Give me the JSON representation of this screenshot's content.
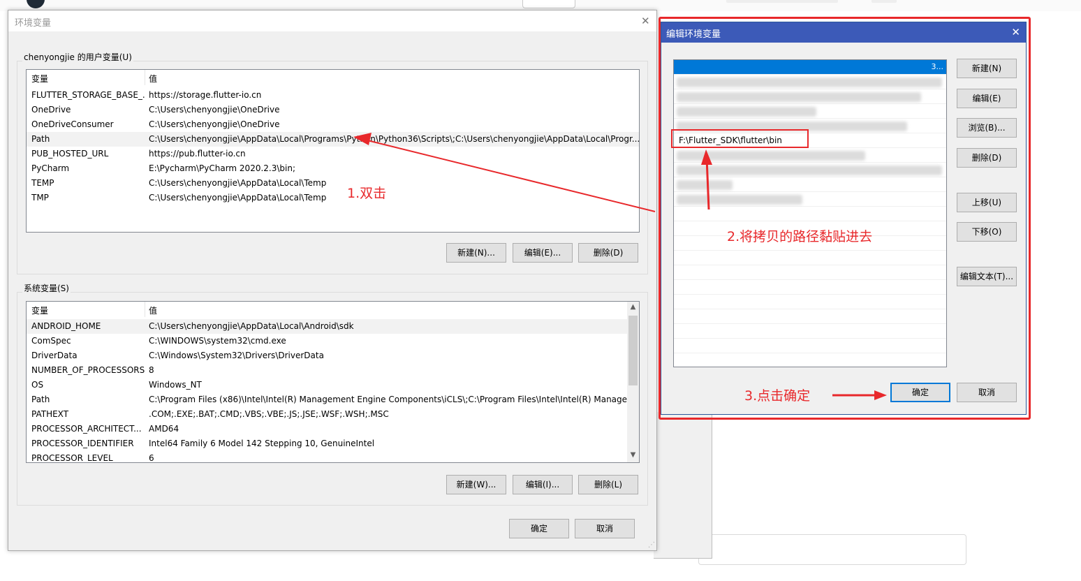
{
  "env_dialog": {
    "title": "环境变量",
    "user_group_label": "chenyongjie 的用户变量(U)",
    "columns": [
      "变量",
      "值"
    ],
    "user_vars": [
      {
        "name": "FLUTTER_STORAGE_BASE_...",
        "value": "https://storage.flutter-io.cn"
      },
      {
        "name": "OneDrive",
        "value": "C:\\Users\\chenyongjie\\OneDrive"
      },
      {
        "name": "OneDriveConsumer",
        "value": "C:\\Users\\chenyongjie\\OneDrive"
      },
      {
        "name": "Path",
        "value": "C:\\Users\\chenyongjie\\AppData\\Local\\Programs\\Python\\Python36\\Scripts\\;C:\\Users\\chenyongjie\\AppData\\Local\\Progr..."
      },
      {
        "name": "PUB_HOSTED_URL",
        "value": "https://pub.flutter-io.cn"
      },
      {
        "name": "PyCharm",
        "value": "E:\\Pycharm\\PyCharm 2020.2.3\\bin;"
      },
      {
        "name": "TEMP",
        "value": "C:\\Users\\chenyongjie\\AppData\\Local\\Temp"
      },
      {
        "name": "TMP",
        "value": "C:\\Users\\chenyongjie\\AppData\\Local\\Temp"
      }
    ],
    "user_buttons": {
      "new": "新建(N)...",
      "edit": "编辑(E)...",
      "delete": "删除(D)"
    },
    "system_group_label": "系统变量(S)",
    "system_vars": [
      {
        "name": "ANDROID_HOME",
        "value": "C:\\Users\\chenyongjie\\AppData\\Local\\Android\\sdk"
      },
      {
        "name": "ComSpec",
        "value": "C:\\WINDOWS\\system32\\cmd.exe"
      },
      {
        "name": "DriverData",
        "value": "C:\\Windows\\System32\\Drivers\\DriverData"
      },
      {
        "name": "NUMBER_OF_PROCESSORS",
        "value": "8"
      },
      {
        "name": "OS",
        "value": "Windows_NT"
      },
      {
        "name": "Path",
        "value": "C:\\Program Files (x86)\\Intel\\Intel(R) Management Engine Components\\iCLS\\;C:\\Program Files\\Intel\\Intel(R) Manage..."
      },
      {
        "name": "PATHEXT",
        "value": ".COM;.EXE;.BAT;.CMD;.VBS;.VBE;.JS;.JSE;.WSF;.WSH;.MSC"
      },
      {
        "name": "PROCESSOR_ARCHITECT...",
        "value": "AMD64"
      },
      {
        "name": "PROCESSOR_IDENTIFIER",
        "value": "Intel64 Family 6 Model 142 Stepping 10, GenuineIntel"
      },
      {
        "name": "PROCESSOR_LEVEL",
        "value": "6"
      }
    ],
    "system_buttons": {
      "new": "新建(W)...",
      "edit": "编辑(I)...",
      "delete": "删除(L)"
    },
    "ok": "确定",
    "cancel": "取消"
  },
  "edit_dialog": {
    "title": "编辑环境变量",
    "selected_suffix": "3...",
    "visible_entry": "F:\\Flutter_SDK\\flutter\\bin",
    "buttons": {
      "new": "新建(N)",
      "edit": "编辑(E)",
      "browse": "浏览(B)...",
      "delete": "删除(D)",
      "move_up": "上移(U)",
      "move_down": "下移(O)",
      "edit_text": "编辑文本(T)...",
      "ok": "确定",
      "cancel": "取消"
    }
  },
  "annotations": {
    "step1": "1.双击",
    "step2": "2.将拷贝的路径黏贴进去",
    "step3": "3.点击确定"
  },
  "colors": {
    "annotation": "#e8282b",
    "title_bar_active": "#3c5ab8",
    "selection": "#0078d7"
  }
}
